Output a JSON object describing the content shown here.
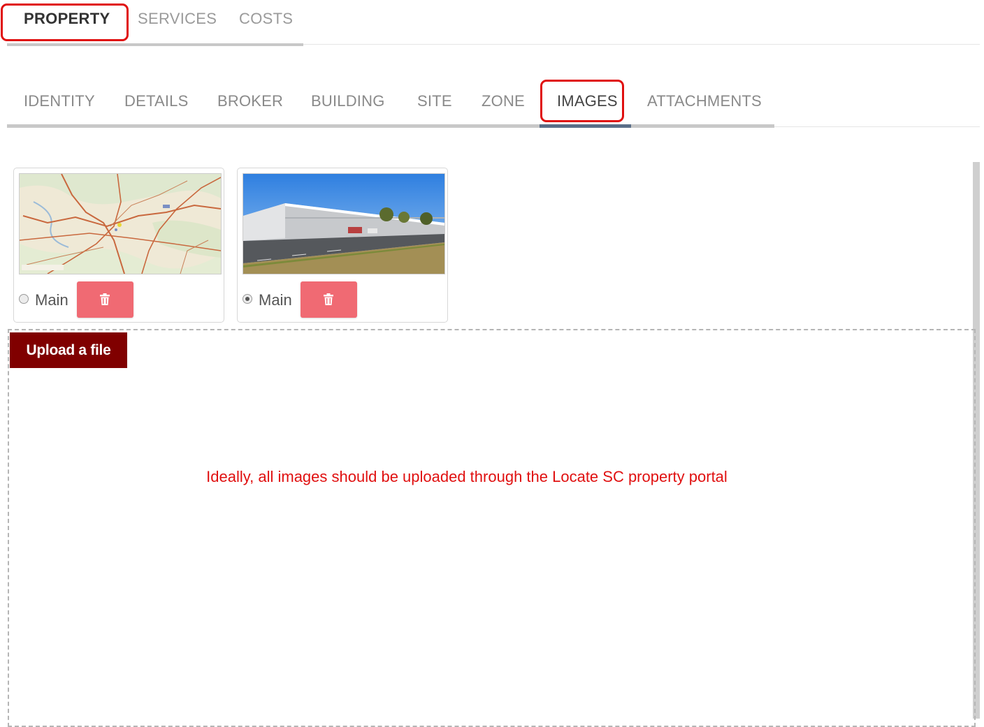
{
  "top_tabs": [
    {
      "label": "PROPERTY",
      "active": true
    },
    {
      "label": "SERVICES",
      "active": false
    },
    {
      "label": "COSTS",
      "active": false
    }
  ],
  "sub_tabs": [
    {
      "label": "IDENTITY",
      "active": false
    },
    {
      "label": "DETAILS",
      "active": false
    },
    {
      "label": "BROKER",
      "active": false
    },
    {
      "label": "BUILDING",
      "active": false
    },
    {
      "label": "SITE",
      "active": false
    },
    {
      "label": "ZONE",
      "active": false
    },
    {
      "label": "IMAGES",
      "active": true
    },
    {
      "label": "ATTACHMENTS",
      "active": false
    }
  ],
  "images": [
    {
      "thumbnail": "map-image",
      "radio_label": "Main",
      "selected": false,
      "delete_icon": "trash-icon"
    },
    {
      "thumbnail": "building-photo",
      "radio_label": "Main",
      "selected": true,
      "delete_icon": "trash-icon"
    }
  ],
  "upload": {
    "button_label": "Upload a file"
  },
  "note": "Ideally, all images should be uploaded through the Locate SC property portal",
  "colors": {
    "highlight": "#e01010",
    "upload_button": "#800000",
    "delete_button": "#f06a73",
    "note_text": "#e01010",
    "active_tab_bar": "#5a6e88"
  }
}
